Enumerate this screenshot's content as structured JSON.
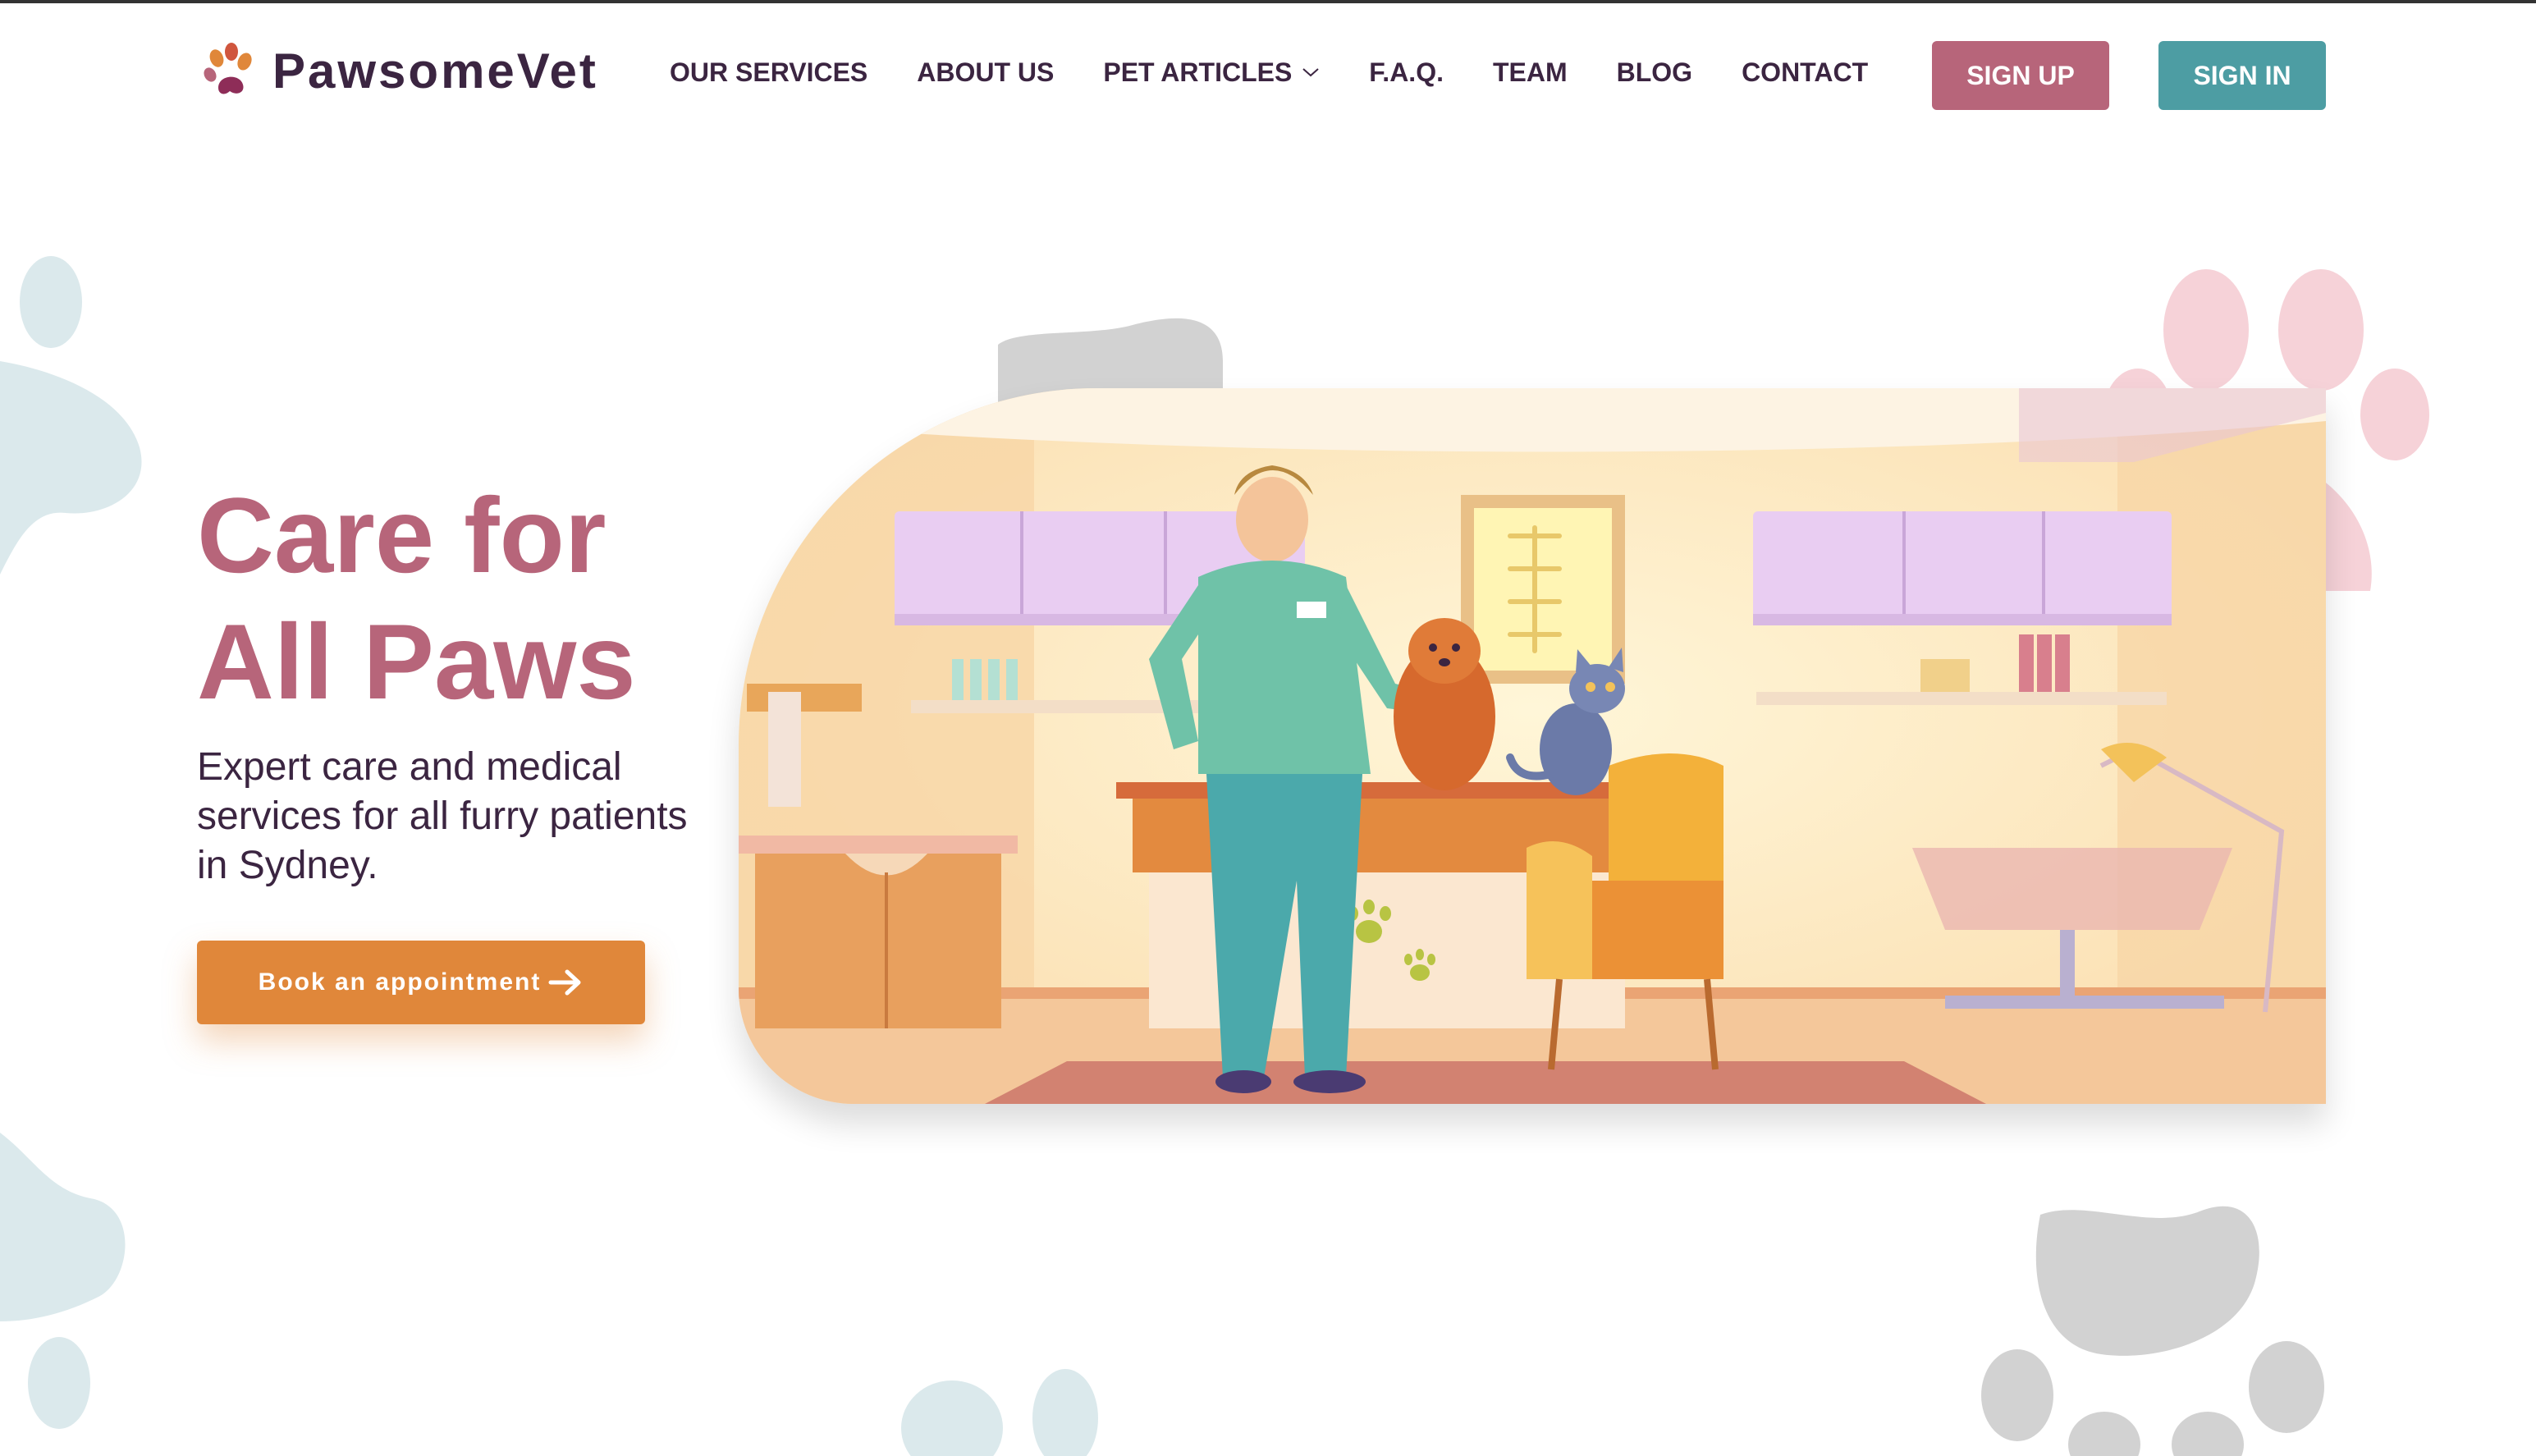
{
  "brand": {
    "name": "PawsomeVet",
    "logo_icon": "paw-logo-icon",
    "colors": {
      "primary": "#b7657a",
      "secondary": "#4d9da3",
      "accent": "#e0873a",
      "text": "#3b2541"
    }
  },
  "nav": {
    "items": [
      {
        "label": "OUR SERVICES"
      },
      {
        "label": "ABOUT US"
      },
      {
        "label": "PET ARTICLES",
        "icon": "chevron-down-icon"
      },
      {
        "label": "F.A.Q."
      },
      {
        "label": "TEAM"
      },
      {
        "label": "BLOG"
      },
      {
        "label": "CONTACT"
      }
    ]
  },
  "auth": {
    "signup_label": "SIGN UP",
    "signin_label": "SIGN IN"
  },
  "hero": {
    "title_line1": "Care for",
    "title_line2": "All Paws",
    "subtitle": "Expert care and medical services for all furry patients in Sydney.",
    "cta_label": "Book an appointment",
    "cta_icon": "arrow-right-icon",
    "image": "vet-clinic-illustration"
  }
}
